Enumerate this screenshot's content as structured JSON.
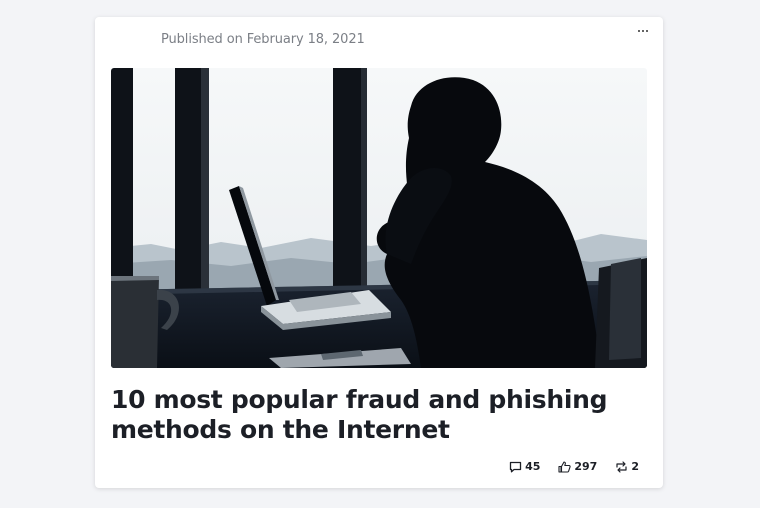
{
  "post": {
    "published": "Published on February 18, 2021",
    "title": "10 most popular fraud and phishing methods on the Internet",
    "image_alt": "Silhouette of a man with his hand on his face sitting at a laptop by a window"
  },
  "stats": {
    "comments": "45",
    "likes": "297",
    "reposts": "2"
  },
  "icons": {
    "menu": "more-horizontal-icon",
    "comments": "comment-icon",
    "likes": "thumbs-up-icon",
    "reposts": "repost-icon"
  }
}
